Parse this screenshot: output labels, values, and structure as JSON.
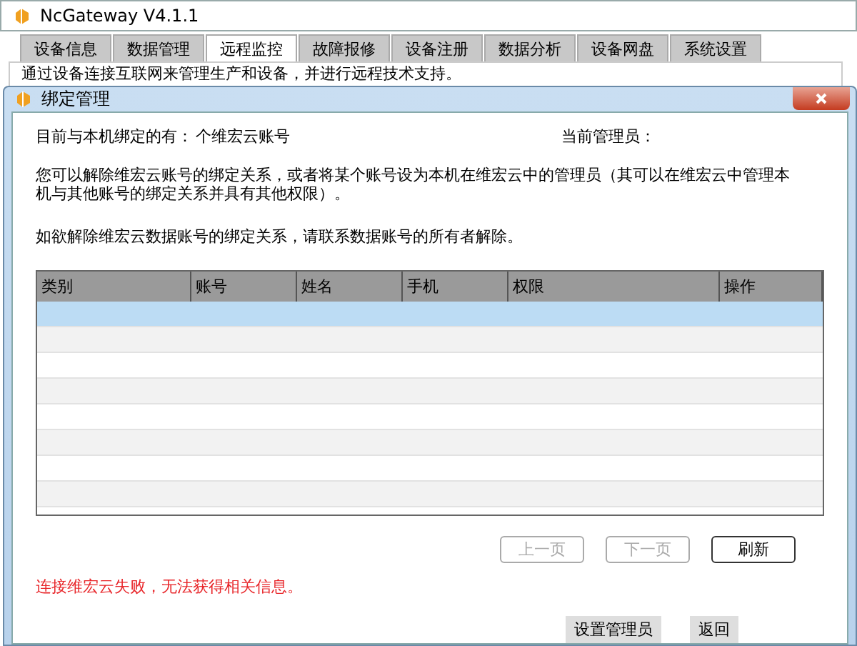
{
  "window": {
    "title": "NcGateway V4.1.1"
  },
  "tabs": [
    {
      "label": "设备信息",
      "selected": false
    },
    {
      "label": "数据管理",
      "selected": false
    },
    {
      "label": "远程监控",
      "selected": true
    },
    {
      "label": "故障报修",
      "selected": false
    },
    {
      "label": "设备注册",
      "selected": false
    },
    {
      "label": "数据分析",
      "selected": false
    },
    {
      "label": "设备网盘",
      "selected": false
    },
    {
      "label": "系统设置",
      "selected": false
    }
  ],
  "tab_description": "通过设备连接互联网来管理生产和设备，并进行远程技术支持。",
  "dialog": {
    "title": "绑定管理",
    "bound_label": "目前与本机绑定的有：",
    "bound_count": "个维宏云账号",
    "admin_label": "当前管理员：",
    "info_1": "您可以解除维宏云账号的绑定关系，或者将某个账号设为本机在维宏云中的管理员（其可以在维宏云中管理本机与其他账号的绑定关系并具有其他权限）。",
    "info_2": "如欲解除维宏云数据账号的绑定关系，请联系数据账号的所有者解除。",
    "table": {
      "columns": [
        "类别",
        "账号",
        "姓名",
        "手机",
        "权限",
        "操作"
      ],
      "rows": [
        {
          "selected": true
        },
        {
          "selected": false
        },
        {
          "selected": false
        },
        {
          "selected": false
        },
        {
          "selected": false
        },
        {
          "selected": false
        },
        {
          "selected": false
        },
        {
          "selected": false
        }
      ]
    },
    "pager": [
      {
        "label": "上一页",
        "disabled": true
      },
      {
        "label": "下一页",
        "disabled": true
      },
      {
        "label": "刷新",
        "disabled": false
      }
    ],
    "error": "连接维宏云失败，无法获得相关信息。",
    "buttons": [
      {
        "label": "设置管理员"
      },
      {
        "label": "返回"
      }
    ]
  }
}
